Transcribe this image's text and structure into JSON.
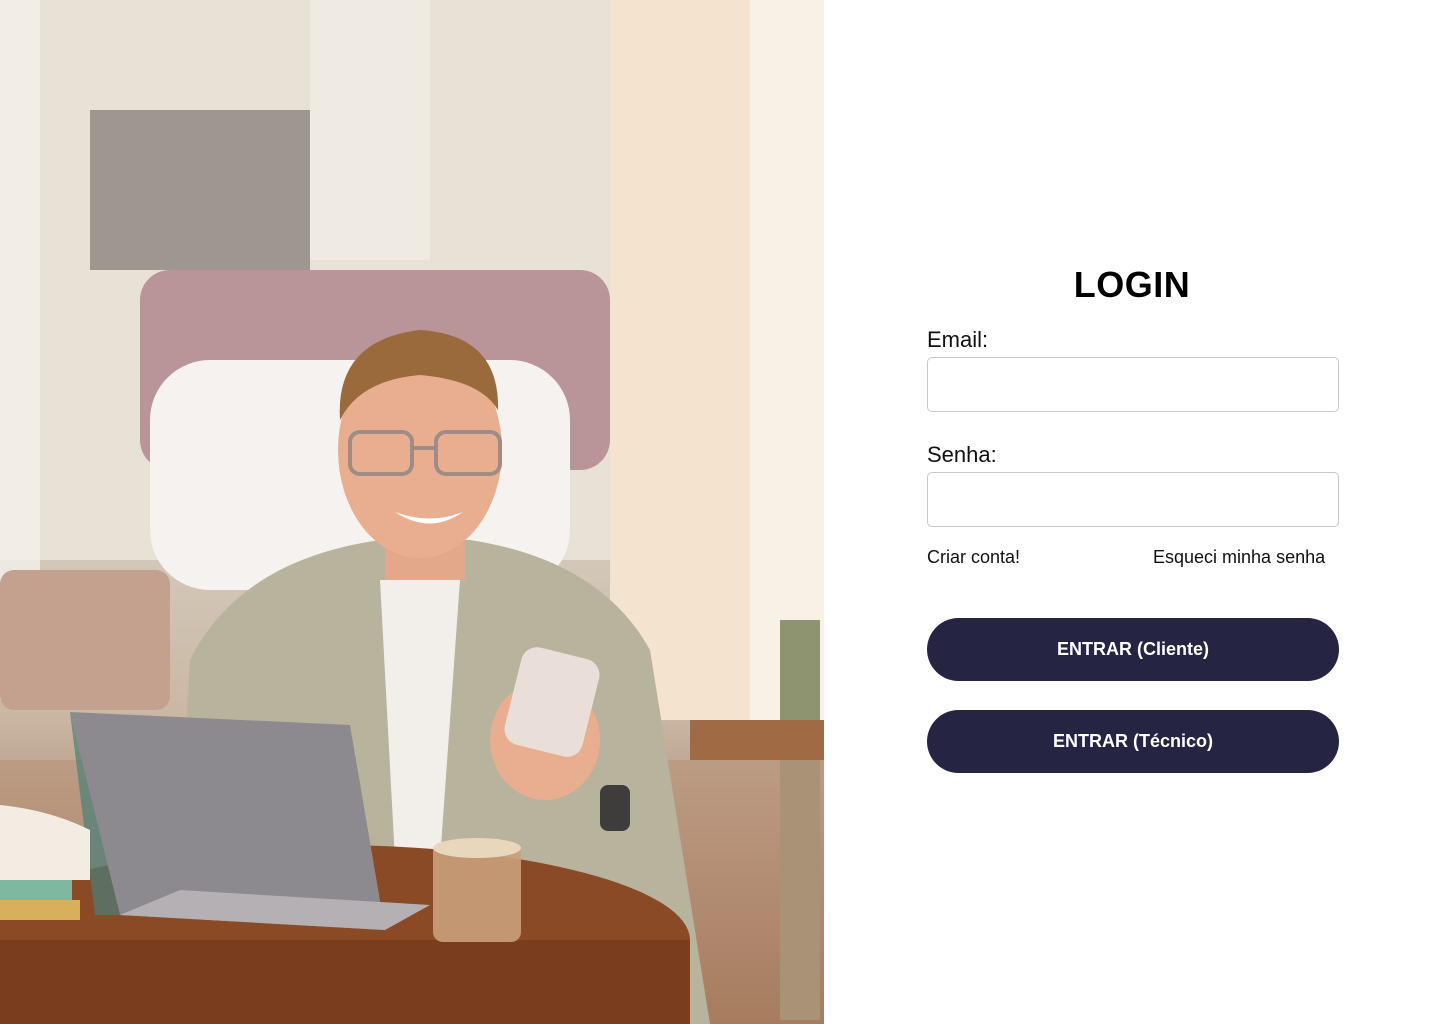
{
  "hero": {
    "image": "person-smiling-with-laptop-and-phone-in-cafe"
  },
  "login": {
    "title": "LOGIN",
    "email_label": "Email:",
    "email_value": "",
    "password_label": "Senha:",
    "password_value": "",
    "create_account_link": "Criar conta!",
    "forgot_password_link": "Esqueci minha senha",
    "client_button": "ENTRAR (Cliente)",
    "technician_button": "ENTRAR (Técnico)"
  },
  "colors": {
    "button_bg": "#262443",
    "button_text": "#ffffff",
    "panel_bg": "#ffffff",
    "input_border": "#c8c8c8"
  }
}
